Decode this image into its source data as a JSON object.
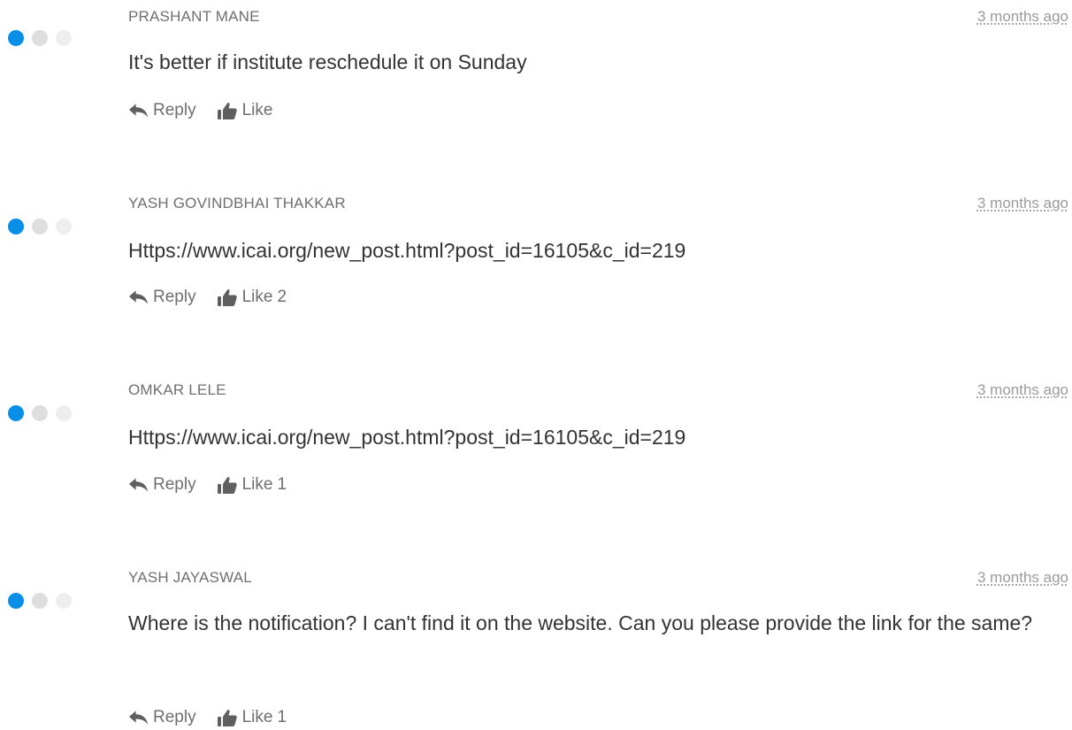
{
  "comments": [
    {
      "author": "PRASHANT MANE",
      "time": "3 months ago",
      "message": "It's better if institute reschedule it on Sunday",
      "reply_label": "Reply",
      "like_label": "Like",
      "like_count": ""
    },
    {
      "author": "YASH GOVINDBHAI THAKKAR",
      "time": "3 months ago",
      "message": "Https://www.icai.org/new_post.html?post_id=16105&c_id=219",
      "reply_label": "Reply",
      "like_label": "Like",
      "like_count": "2"
    },
    {
      "author": "OMKAR LELE",
      "time": "3 months ago",
      "message": "Https://www.icai.org/new_post.html?post_id=16105&c_id=219",
      "reply_label": "Reply",
      "like_label": "Like",
      "like_count": "1"
    },
    {
      "author": "YASH JAYASWAL",
      "time": "3 months ago",
      "message": "Where is the notification? I can't find it on the website. Can you please provide the link for the same?",
      "reply_label": "Reply",
      "like_label": "Like",
      "like_count": "1"
    }
  ],
  "icons": {
    "reply": "reply-icon",
    "like": "thumbs-up-icon"
  },
  "colors": {
    "avatar_dot_primary": "#0a8fe8",
    "avatar_dot_secondary": "#dedede",
    "avatar_dot_tertiary": "#eeeeee",
    "author_text": "#6f6f6f",
    "timestamp_text": "#9b9b9b",
    "message_text": "#333333"
  }
}
